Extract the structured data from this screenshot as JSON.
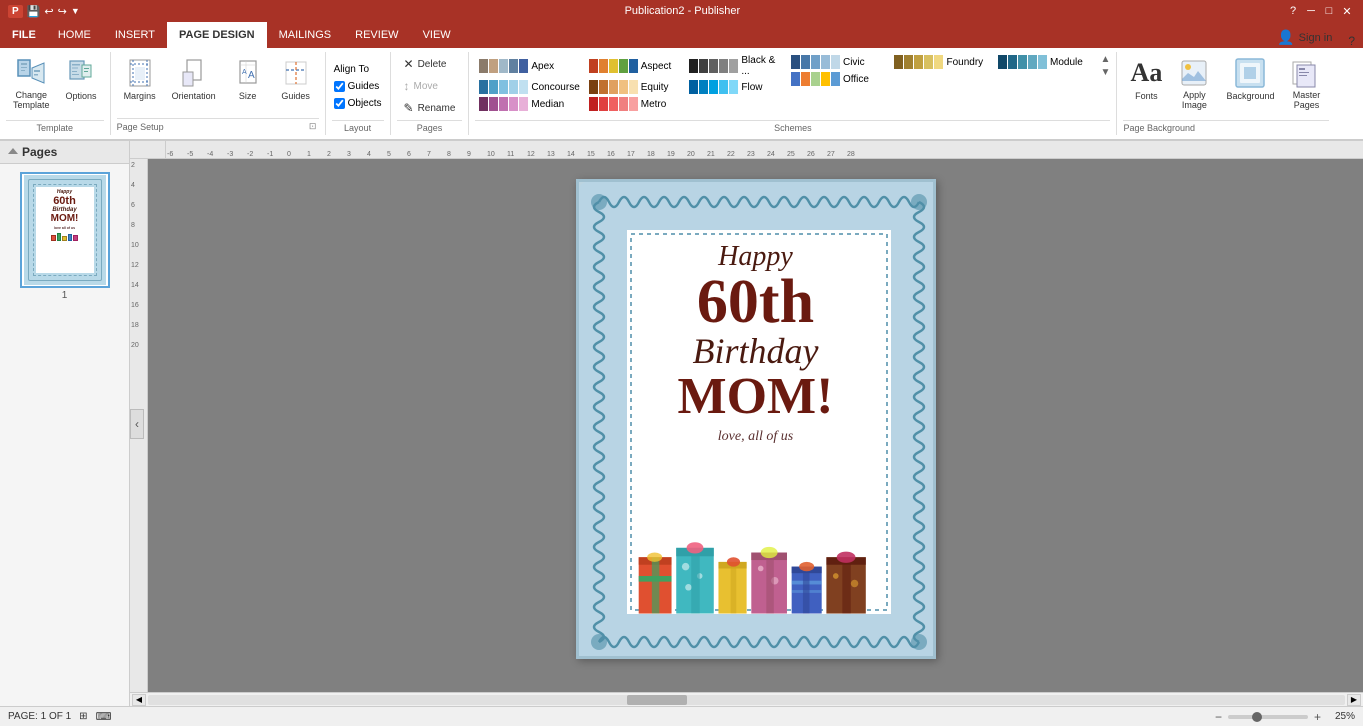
{
  "titlebar": {
    "title": "Publication2 - Publisher",
    "help_icon": "?",
    "minimize": "─",
    "maximize": "□",
    "close": "✕",
    "quick_access": [
      "save",
      "undo",
      "redo",
      "customize"
    ]
  },
  "tabs": {
    "file_label": "FILE",
    "items": [
      "HOME",
      "INSERT",
      "PAGE DESIGN",
      "MAILINGS",
      "REVIEW",
      "VIEW"
    ],
    "active": "PAGE DESIGN"
  },
  "ribbon": {
    "groups": {
      "template": {
        "label": "Template",
        "change_label": "Change\nTemplate",
        "options_label": "Options"
      },
      "page_setup": {
        "label": "Page Setup",
        "margins_label": "Margins",
        "orientation_label": "Orientation",
        "size_label": "Size",
        "guides_label": "Guides",
        "expand_icon": "⊠"
      },
      "layout": {
        "label": "Layout",
        "align_to": "Align To",
        "guides": "Guides",
        "objects": "Objects"
      },
      "pages": {
        "label": "Pages",
        "delete": "Delete",
        "move": "Move",
        "rename": "Rename"
      },
      "schemes": {
        "label": "Schemes",
        "items": [
          {
            "name": "Apex",
            "colors": [
              "#8b7b6b",
              "#c0a080",
              "#a0b8c8",
              "#6080a0",
              "#4060a0"
            ]
          },
          {
            "name": "Aspect",
            "colors": [
              "#c04020",
              "#e08030",
              "#e0c030",
              "#60a040",
              "#2060a0"
            ]
          },
          {
            "name": "Black &...",
            "colors": [
              "#202020",
              "#404040",
              "#606060",
              "#808080",
              "#a0a0a0"
            ]
          },
          {
            "name": "Concourse",
            "colors": [
              "#2870a0",
              "#50a0c8",
              "#80c0e0",
              "#a0d0e8",
              "#c0e0f0"
            ]
          },
          {
            "name": "Equity",
            "colors": [
              "#7a4010",
              "#c07030",
              "#e0a060",
              "#f0c080",
              "#f8e0b0"
            ]
          },
          {
            "name": "Flow",
            "colors": [
              "#0060a0",
              "#0080c0",
              "#00a0e0",
              "#40c0f0",
              "#80d8f8"
            ]
          },
          {
            "name": "Median",
            "colors": [
              "#703060",
              "#a05090",
              "#c070b0",
              "#d890c8",
              "#e8b0d8"
            ]
          },
          {
            "name": "Metro",
            "colors": [
              "#c02020",
              "#e04040",
              "#f06060",
              "#f08080",
              "#f8a0a0"
            ]
          },
          {
            "name": "Civic",
            "colors": [
              "#2a5080",
              "#4878a8",
              "#70a0c8",
              "#98bcd8",
              "#c0d8e8"
            ]
          },
          {
            "name": "Foundry",
            "colors": [
              "#806020",
              "#a08030",
              "#c0a040",
              "#d8c060",
              "#f0d880"
            ]
          },
          {
            "name": "Module",
            "colors": [
              "#104868",
              "#206888",
              "#4090a8",
              "#60a8c0",
              "#80c0d8"
            ]
          },
          {
            "name": "Office",
            "colors": [
              "#4472c4",
              "#ed7d31",
              "#a9d18e",
              "#ffc000",
              "#5b9bd5"
            ]
          }
        ]
      },
      "page_background": {
        "label": "Page Background",
        "fonts_label": "Fonts",
        "background_label": "Background",
        "master_pages_label": "Master\nPages",
        "apply_image_label": "Apply\nImage",
        "fonts_display": "Aa"
      }
    }
  },
  "pages_panel": {
    "title": "Pages",
    "page_number": "1",
    "page_thumb_lines": [
      "Happy",
      "60th",
      "Birthday",
      "MOM!",
      "love all of us"
    ]
  },
  "card": {
    "line1": "Happy",
    "line2": "60th",
    "line3": "Birthday",
    "line4": "MOM!",
    "subtitle": "love, all of us"
  },
  "statusbar": {
    "page_info": "PAGE: 1 OF 1",
    "zoom_label": "25%",
    "layout_icon": "⊞"
  },
  "signin": {
    "label": "Sign in"
  }
}
